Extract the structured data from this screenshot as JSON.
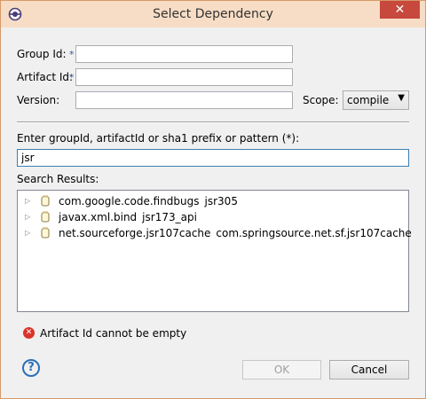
{
  "window": {
    "title": "Select Dependency",
    "close_label": "✕"
  },
  "form": {
    "group_id_label": "Group Id:",
    "artifact_id_label": "Artifact Id:",
    "version_label": "Version:",
    "required_marker": "*",
    "group_id_value": "",
    "artifact_id_value": "",
    "version_value": "",
    "scope_label": "Scope:",
    "scope_value": "compile"
  },
  "search": {
    "prompt_label": "Enter groupId, artifactId or sha1 prefix or pattern (*):",
    "query": "jsr",
    "results_label": "Search Results:",
    "results": [
      {
        "group": "com.google.code.findbugs",
        "artifact": "jsr305"
      },
      {
        "group": "javax.xml.bind",
        "artifact": "jsr173_api"
      },
      {
        "group": "net.sourceforge.jsr107cache",
        "artifact": "com.springsource.net.sf.jsr107cache"
      }
    ]
  },
  "status": {
    "error_message": "Artifact Id cannot be empty",
    "error_icon": "error-icon"
  },
  "buttons": {
    "ok_label": "OK",
    "cancel_label": "Cancel",
    "help_icon": "help-icon"
  },
  "colors": {
    "titlebar": "#f7ddc5",
    "close": "#c7483d",
    "error": "#d9342b",
    "help": "#2b6fb8"
  }
}
